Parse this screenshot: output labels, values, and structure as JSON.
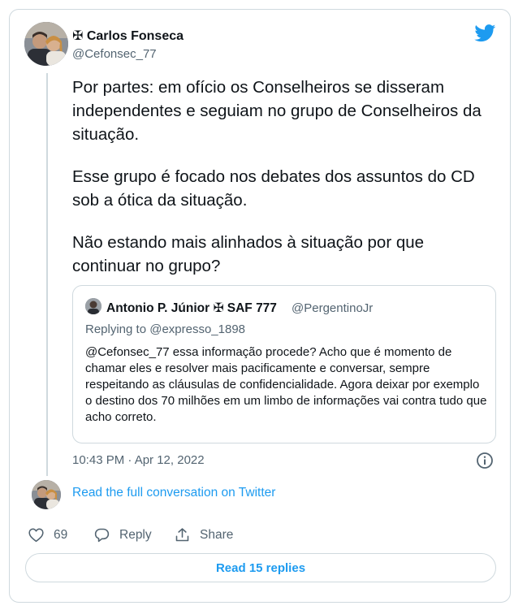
{
  "tweet": {
    "author_name": "✠ Carlos Fonseca",
    "author_handle": "@Cefonsec_77",
    "paragraphs": [
      "Por partes: em ofício os Conselheiros se disseram independentes e seguiam no grupo de Conselheiros da situação.",
      "Esse grupo é focado nos debates dos assuntos do CD sob a ótica da situação.",
      "Não estando mais alinhados à situação por que continuar no grupo?"
    ],
    "timestamp": "10:43 PM · Apr 12, 2022"
  },
  "quoted_tweet": {
    "author_name": "Antonio P. Júnior ✠ SAF 777",
    "author_handle": "@PergentinoJr",
    "replying_to": "Replying to @expresso_1898",
    "text": "@Cefonsec_77 essa informação procede? Acho que é momento de chamar eles e resolver mais pacificamente e conversar, sempre respeitando as cláusulas de confidencialidade. Agora deixar por exemplo o destino dos 70 milhões em um limbo de informações vai contra tudo que acho correto."
  },
  "read_conversation_label": "Read the full conversation on Twitter",
  "actions": {
    "like_count": "69",
    "reply_label": "Reply",
    "share_label": "Share"
  },
  "read_replies_label": "Read 15 replies",
  "icons": {
    "brand": "twitter-bird-icon",
    "info": "info-icon",
    "like": "heart-icon",
    "reply": "speech-bubble-icon",
    "share": "share-upload-icon"
  },
  "colors": {
    "accent": "#1d9bf0",
    "text_primary": "#0f1419",
    "text_secondary": "#536471",
    "border": "#cfd9de"
  }
}
